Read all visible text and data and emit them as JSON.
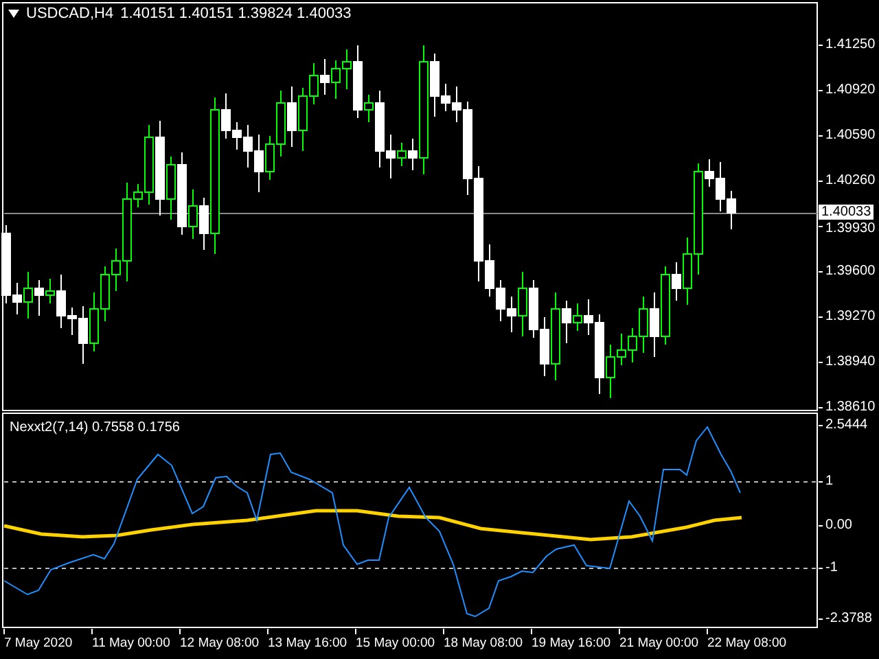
{
  "chart_header": {
    "symbol": "USDCAD,H4",
    "ohlc": "1.40151 1.40151 1.39824 1.40033"
  },
  "price_axis": {
    "ticks": [
      "1.41250",
      "1.40920",
      "1.40590",
      "1.40260",
      "1.39930",
      "1.39600",
      "1.39270",
      "1.38940",
      "1.38610"
    ],
    "current_price": "1.40033"
  },
  "indicator": {
    "label": "Nexxt2(7,14) 0.7558 0.1756",
    "axis_ticks": [
      "2.5444",
      "1",
      "0.00",
      "-1",
      "-2.3788"
    ]
  },
  "time_axis": [
    "7 May 2020",
    "11 May 00:00",
    "12 May 08:00",
    "13 May 16:00",
    "15 May 00:00",
    "18 May 08:00",
    "19 May 16:00",
    "21 May 00:00",
    "22 May 08:00"
  ]
}
